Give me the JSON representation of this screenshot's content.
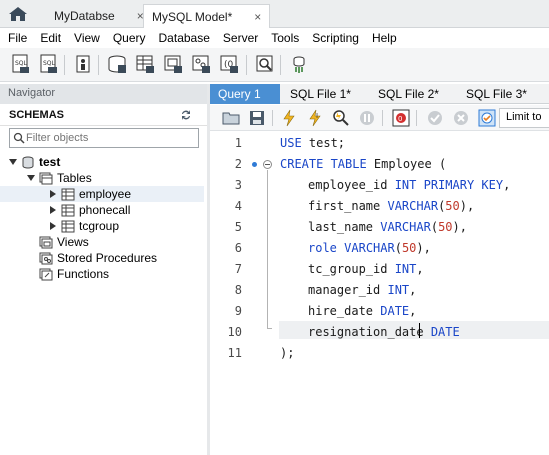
{
  "doc_tabs": [
    {
      "label": "MyDatabse",
      "close": "×",
      "active": false
    },
    {
      "label": "MySQL Model*",
      "close": "×",
      "active": true
    }
  ],
  "menu": [
    "File",
    "Edit",
    "View",
    "Query",
    "Database",
    "Server",
    "Tools",
    "Scripting",
    "Help"
  ],
  "navigator": {
    "title": "Navigator",
    "schemas_label": "SCHEMAS",
    "filter_placeholder": "Filter objects",
    "tree": {
      "schema": "test",
      "tables_label": "Tables",
      "tables": [
        "employee",
        "phonecall",
        "tcgroup"
      ],
      "views_label": "Views",
      "procedures_label": "Stored Procedures",
      "functions_label": "Functions"
    }
  },
  "editor": {
    "tabs": [
      "Query 1",
      "SQL File 1*",
      "SQL File 2*",
      "SQL File 3*"
    ],
    "limit_label": "Limit to",
    "line_numbers": [
      "1",
      "2",
      "3",
      "4",
      "5",
      "6",
      "7",
      "8",
      "9",
      "10",
      "11"
    ],
    "code": {
      "l1_kw": "USE",
      "l1_rest": " test;",
      "l2_kw": "CREATE TABLE",
      "l2_rest": " Employee (",
      "l3_a": "employee_id ",
      "l3_kw": "INT PRIMARY KEY",
      "l3_b": ",",
      "l4_a": "first_name ",
      "l4_kw": "VARCHAR",
      "l4_b": "(",
      "l4_num": "50",
      "l4_c": "),",
      "l5_a": "last_name ",
      "l5_kw": "VARCHAR",
      "l5_b": "(",
      "l5_num": "50",
      "l5_c": "),",
      "l6_kw1": "role",
      "l6_a": " ",
      "l6_kw": "VARCHAR",
      "l6_b": "(",
      "l6_num": "50",
      "l6_c": "),",
      "l7_a": "tc_group_id ",
      "l7_kw": "INT",
      "l7_b": ",",
      "l8_a": "manager_id ",
      "l8_kw": "INT",
      "l8_b": ",",
      "l9_a": "hire_date ",
      "l9_kw": "DATE",
      "l9_b": ",",
      "l10_a": "resignation_date ",
      "l10_kw": "DATE",
      "l11": ");"
    }
  },
  "colors": {
    "accent": "#4a8fd3",
    "keyword": "#1a46c8",
    "number": "#c0392b"
  }
}
